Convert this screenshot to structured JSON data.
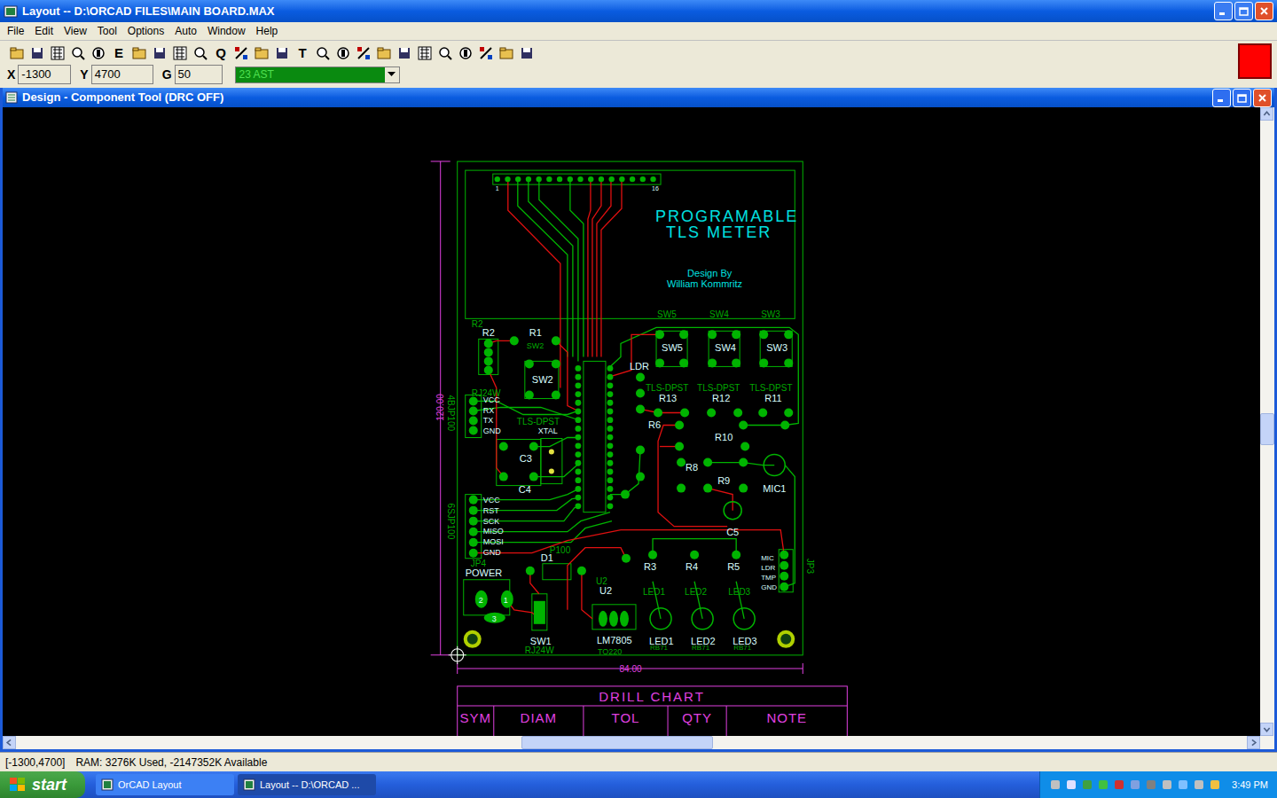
{
  "window": {
    "title": "Layout -- D:\\ORCAD FILES\\MAIN BOARD.MAX"
  },
  "menu": [
    "File",
    "Edit",
    "View",
    "Tool",
    "Options",
    "Auto",
    "Window",
    "Help"
  ],
  "toolbar": [
    {
      "kind": "icon"
    },
    {
      "kind": "icon"
    },
    {
      "kind": "icon"
    },
    {
      "kind": "icon"
    },
    {
      "kind": "icon"
    },
    {
      "kind": "letter",
      "glyph": "E"
    },
    {
      "kind": "icon"
    },
    {
      "kind": "icon"
    },
    {
      "kind": "icon"
    },
    {
      "kind": "icon"
    },
    {
      "kind": "letter",
      "glyph": "Q"
    },
    {
      "kind": "icon"
    },
    {
      "kind": "icon"
    },
    {
      "kind": "icon"
    },
    {
      "kind": "letter",
      "glyph": "T"
    },
    {
      "kind": "icon"
    },
    {
      "kind": "icon"
    },
    {
      "kind": "icon"
    },
    {
      "kind": "icon"
    },
    {
      "kind": "icon"
    },
    {
      "kind": "icon"
    },
    {
      "kind": "icon"
    },
    {
      "kind": "icon"
    },
    {
      "kind": "icon"
    },
    {
      "kind": "icon"
    },
    {
      "kind": "icon"
    }
  ],
  "coords": {
    "x_label": "X",
    "x": "-1300",
    "y_label": "Y",
    "y": "4700",
    "g_label": "G",
    "g": "50",
    "layer": "23 AST"
  },
  "document": {
    "title": "Design - Component Tool (DRC OFF)"
  },
  "pcb": {
    "labels": [
      {
        "text": "PROGRAMABLE",
        "color": "#00e0e0"
      },
      {
        "text": "TLS METER",
        "color": "#00e0e0"
      },
      {
        "text": "Design By",
        "color": "#00e0e0"
      },
      {
        "text": "William Kommritz",
        "color": "#00e0e0"
      },
      {
        "text": "R2",
        "color": "#d8ffff"
      },
      {
        "text": "R1",
        "color": "#d8ffff"
      },
      {
        "text": "SW2",
        "color": "#d8ffff"
      },
      {
        "text": "LDR",
        "color": "#d8ffff"
      },
      {
        "text": "SW5",
        "color": "#d8ffff"
      },
      {
        "text": "SW4",
        "color": "#d8ffff"
      },
      {
        "text": "SW3",
        "color": "#d8ffff"
      },
      {
        "text": "R13",
        "color": "#d8ffff"
      },
      {
        "text": "R12",
        "color": "#d8ffff"
      },
      {
        "text": "R11",
        "color": "#d8ffff"
      },
      {
        "text": "R6",
        "color": "#d8ffff"
      },
      {
        "text": "R10",
        "color": "#d8ffff"
      },
      {
        "text": "R8",
        "color": "#d8ffff"
      },
      {
        "text": "R9",
        "color": "#d8ffff"
      },
      {
        "text": "MIC1",
        "color": "#d8ffff"
      },
      {
        "text": "C5",
        "color": "#d8ffff"
      },
      {
        "text": "C3",
        "color": "#d8ffff"
      },
      {
        "text": "C4",
        "color": "#d8ffff"
      },
      {
        "text": "XTAL",
        "color": "#d8ffff"
      },
      {
        "text": "VCC",
        "color": "#d8ffff"
      },
      {
        "text": "RX",
        "color": "#d8ffff"
      },
      {
        "text": "TX",
        "color": "#d8ffff"
      },
      {
        "text": "GND",
        "color": "#d8ffff"
      },
      {
        "text": "VCC",
        "color": "#d8ffff"
      },
      {
        "text": "RST",
        "color": "#d8ffff"
      },
      {
        "text": "SCK",
        "color": "#d8ffff"
      },
      {
        "text": "MISO",
        "color": "#d8ffff"
      },
      {
        "text": "MOSI",
        "color": "#d8ffff"
      },
      {
        "text": "GND",
        "color": "#d8ffff"
      },
      {
        "text": "POWER",
        "color": "#d8ffff"
      },
      {
        "text": "D1",
        "color": "#d8ffff"
      },
      {
        "text": "U2",
        "color": "#d8ffff"
      },
      {
        "text": "R3",
        "color": "#d8ffff"
      },
      {
        "text": "R4",
        "color": "#d8ffff"
      },
      {
        "text": "R5",
        "color": "#d8ffff"
      },
      {
        "text": "SW1",
        "color": "#d8ffff"
      },
      {
        "text": "LM7805",
        "color": "#d8ffff"
      },
      {
        "text": "LED1",
        "color": "#d8ffff"
      },
      {
        "text": "LED2",
        "color": "#d8ffff"
      },
      {
        "text": "LED3",
        "color": "#d8ffff"
      },
      {
        "text": "MIC",
        "color": "#d8ffff"
      },
      {
        "text": "LDR",
        "color": "#d8ffff"
      },
      {
        "text": "TMP",
        "color": "#d8ffff"
      },
      {
        "text": "GND",
        "color": "#d8ffff"
      },
      {
        "text": "2",
        "color": "#d8ffff"
      },
      {
        "text": "1",
        "color": "#d8ffff"
      },
      {
        "text": "3",
        "color": "#d8ffff"
      },
      {
        "text": "SW5",
        "color": "#00a800"
      },
      {
        "text": "SW4",
        "color": "#00a800"
      },
      {
        "text": "SW3",
        "color": "#00a800"
      },
      {
        "text": "TLS-DPST",
        "color": "#00a800"
      },
      {
        "text": "TLS-DPST",
        "color": "#00a800"
      },
      {
        "text": "TLS-DPST",
        "color": "#00a800"
      },
      {
        "text": "RJ24W",
        "color": "#00a800"
      },
      {
        "text": "TO220",
        "color": "#00a800"
      },
      {
        "text": "RB71",
        "color": "#00a800"
      },
      {
        "text": "RB71",
        "color": "#00a800"
      },
      {
        "text": "RB71",
        "color": "#00a800"
      },
      {
        "text": "JP4",
        "color": "#00a800"
      },
      {
        "text": "U2",
        "color": "#00a800"
      },
      {
        "text": "LED1",
        "color": "#00a800"
      },
      {
        "text": "LED2",
        "color": "#00a800"
      },
      {
        "text": "LED3",
        "color": "#00a800"
      },
      {
        "text": "R2",
        "color": "#00a800"
      },
      {
        "text": "SW2",
        "color": "#00a800"
      },
      {
        "text": "RJ24W",
        "color": "#00a800"
      },
      {
        "text": "TLS-DPST",
        "color": "#00a800"
      },
      {
        "text": "P100",
        "color": "#00a800"
      },
      {
        "text": "JP3",
        "color": "#00a800"
      },
      {
        "text": "4BJP100",
        "color": "#00a800"
      },
      {
        "text": "6SJP100",
        "color": "#00a800"
      },
      {
        "text": "1",
        "color": "#d8ffff"
      },
      {
        "text": "16",
        "color": "#d8ffff"
      }
    ],
    "dimensions": {
      "width": "84.00",
      "height": "120.00"
    },
    "drill_chart": {
      "title": "DRILL CHART",
      "columns": [
        "SYM",
        "DIAM",
        "TOL",
        "QTY",
        "NOTE"
      ]
    }
  },
  "status_bar": {
    "coords": "[-1300,4700]",
    "memory": "RAM: 3276K Used, -2147352K Available"
  },
  "taskbar": {
    "start": "start",
    "tasks": [
      {
        "label": "OrCAD Layout",
        "selected": false
      },
      {
        "label": "Layout -- D:\\ORCAD ...",
        "selected": true
      }
    ],
    "time": "3:49 PM"
  }
}
